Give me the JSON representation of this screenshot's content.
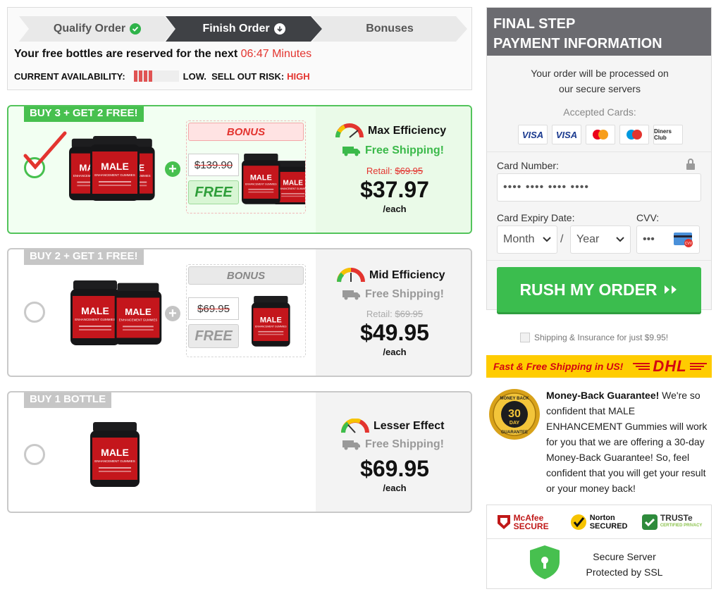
{
  "steps": {
    "qualify": "Qualify Order",
    "finish": "Finish Order",
    "bonuses": "Bonuses"
  },
  "reserve": {
    "text": "Your free bottles are reserved for the next ",
    "timer": "06:47 Minutes"
  },
  "availability": {
    "label": "CURRENT AVAILABILITY:",
    "level": "LOW.",
    "risk_label": "SELL OUT RISK:",
    "risk": "HIGH"
  },
  "packages": [
    {
      "tag": "BUY 3 + GET 2 FREE!",
      "selected": true,
      "bonus_label": "BONUS",
      "old_price": "$139.90",
      "free_label": "FREE",
      "efficiency": "Max Efficiency",
      "shipping": "Free Shipping!",
      "retail_label": "Retail:",
      "retail": "$69.95",
      "price": "$37.97",
      "per": "/each"
    },
    {
      "tag": "BUY 2 + GET 1 FREE!",
      "selected": false,
      "bonus_label": "BONUS",
      "old_price": "$69.95",
      "free_label": "FREE",
      "efficiency": "Mid Efficiency",
      "shipping": "Free Shipping!",
      "retail_label": "Retail:",
      "retail": "$69.95",
      "price": "$49.95",
      "per": "/each"
    },
    {
      "tag": "BUY 1 BOTTLE",
      "selected": false,
      "efficiency": "Lesser Effect",
      "shipping": "Free Shipping!",
      "price": "$69.95",
      "per": "/each"
    }
  ],
  "jar": {
    "brand": "MALE",
    "subtitle": "ENHANCEMENT GUMMIES"
  },
  "payment": {
    "title_line1": "FINAL STEP",
    "title_line2": "PAYMENT INFORMATION",
    "processed_line1": "Your order will be processed on",
    "processed_line2": "our secure servers",
    "accepted": "Accepted Cards:",
    "cards": [
      "VISA",
      "VISA",
      "mastercard",
      "maestro",
      "Diners Club"
    ],
    "card_number_label": "Card Number:",
    "card_number_placeholder": "•••• •••• •••• ••••",
    "expiry_label": "Card Expiry Date:",
    "cvv_label": "CVV:",
    "month": "Month",
    "year": "Year",
    "separator": "/",
    "cvv_placeholder": "•••",
    "cvv_badge": "CVV",
    "button": "RUSH MY ORDER"
  },
  "insurance": "Shipping & Insurance for just $9.95!",
  "dhl": {
    "text": "Fast & Free Shipping in US!",
    "logo": "DHL"
  },
  "guarantee": {
    "title": "Money-Back Guarantee!",
    "body": " We're so confident that MALE ENHANCEMENT Gummies will work for you that we are offering a 30-day Money-Back Guarantee! So, feel confident that you will get your result or your money back!",
    "seal_top": "MONEY BACK",
    "seal_num": "30",
    "seal_day": "DAY",
    "seal_bottom": "GUARANTEE"
  },
  "trust": {
    "mcafee": "McAfee SECURE",
    "norton": "Norton SECURED",
    "truste": "TRUSTe",
    "truste_sub": "CERTIFIED PRIVACY",
    "ssl_line1": "Secure Server",
    "ssl_line2": "Protected by SSL"
  },
  "colors": {
    "green": "#3bbd4e",
    "red": "#e3342f",
    "header_gray": "#6b6b70",
    "dhl_yellow": "#ffcc00"
  }
}
